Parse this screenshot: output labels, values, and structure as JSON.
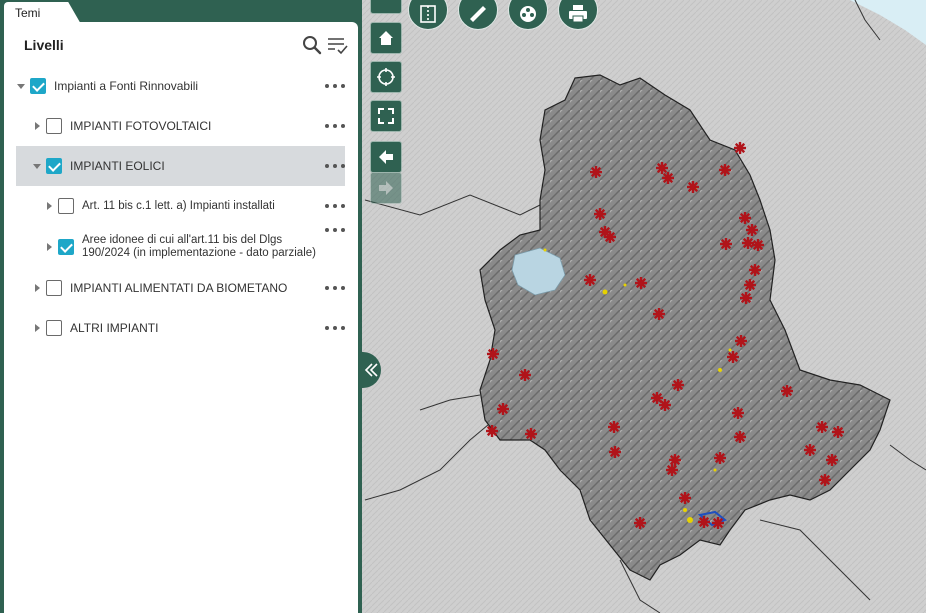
{
  "tab": {
    "label": "Temi"
  },
  "panel": {
    "title": "Livelli",
    "layers": [
      {
        "label": "Impianti a Fonti Rinnovabili",
        "checked": true,
        "expanded": true
      },
      {
        "label": "IMPIANTI FOTOVOLTAICI",
        "checked": false,
        "expanded": false
      },
      {
        "label": "IMPIANTI EOLICI",
        "checked": true,
        "expanded": true
      },
      {
        "label": "Art. 11 bis c.1 lett. a) Impianti installati",
        "checked": false,
        "expanded": false
      },
      {
        "label": "Aree idonee di cui all'art.11 bis del Dlgs 190/2024 (in implementazione - dato parziale)",
        "checked": true,
        "expanded": false
      },
      {
        "label": "IMPIANTI ALIMENTATI DA BIOMETANO",
        "checked": false,
        "expanded": false
      },
      {
        "label": "ALTRI IMPIANTI",
        "checked": false,
        "expanded": false
      }
    ]
  },
  "map": {
    "tools_top": [
      "split-view-icon",
      "ruler-icon",
      "film-reel-icon",
      "printer-icon"
    ],
    "tools_left": [
      "home-icon",
      "locate-icon",
      "fullscreen-icon",
      "back-arrow-icon",
      "forward-arrow-icon"
    ],
    "colors": {
      "turbine": "#b0141a",
      "region": "#8d8d8d",
      "lake": "#b9d5e2",
      "ui": "#2f6151",
      "checkbox": "#1ea7c8"
    }
  }
}
